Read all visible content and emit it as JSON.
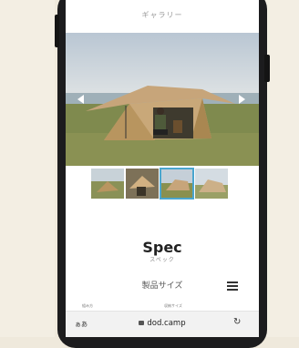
{
  "gallery": {
    "title": "ギャラリー"
  },
  "spec": {
    "title": "Spec",
    "subtitle": "スペック"
  },
  "size_section": {
    "label": "製品サイズ"
  },
  "columns": {
    "left": "組み方",
    "right": "収納サイズ"
  },
  "browser": {
    "aa_label": "ぁあ",
    "url": "dod.camp",
    "reload_icon": "reload-icon"
  },
  "thumbnails": {
    "count": 4,
    "active_index": 2
  },
  "colors": {
    "accent": "#4aa6cf",
    "tent": "#c7a57a"
  }
}
